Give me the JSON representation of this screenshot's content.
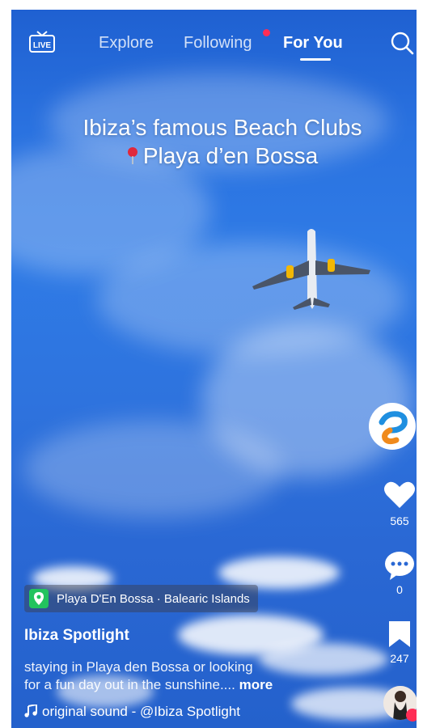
{
  "topbar": {
    "live_label": "LIVE",
    "tabs": [
      "Explore",
      "Following",
      "For You"
    ],
    "active_tab": "For You"
  },
  "video": {
    "overlay_line1": "Ibiza’s famous Beach Clubs",
    "overlay_line2": "Playa d’en Bossa"
  },
  "actions": {
    "likes": "565",
    "comments": "0",
    "saves": "247"
  },
  "post": {
    "location": "Playa D'En Bossa · Balearic Islands",
    "username": "Ibiza Spotlight",
    "caption_line1": "staying in Playa den Bossa or looking",
    "caption_line2": "for a fun day out in the sunshine....",
    "more_label": "more",
    "sound": "original sound - @Ibiza Spotlight"
  },
  "colors": {
    "accent": "#ff2d55",
    "location_green": "#22c35e"
  },
  "icons": [
    "live-icon",
    "search-icon",
    "map-pin-icon",
    "heart-icon",
    "comment-icon",
    "bookmark-icon",
    "music-note-icon",
    "app-logo-icon"
  ]
}
